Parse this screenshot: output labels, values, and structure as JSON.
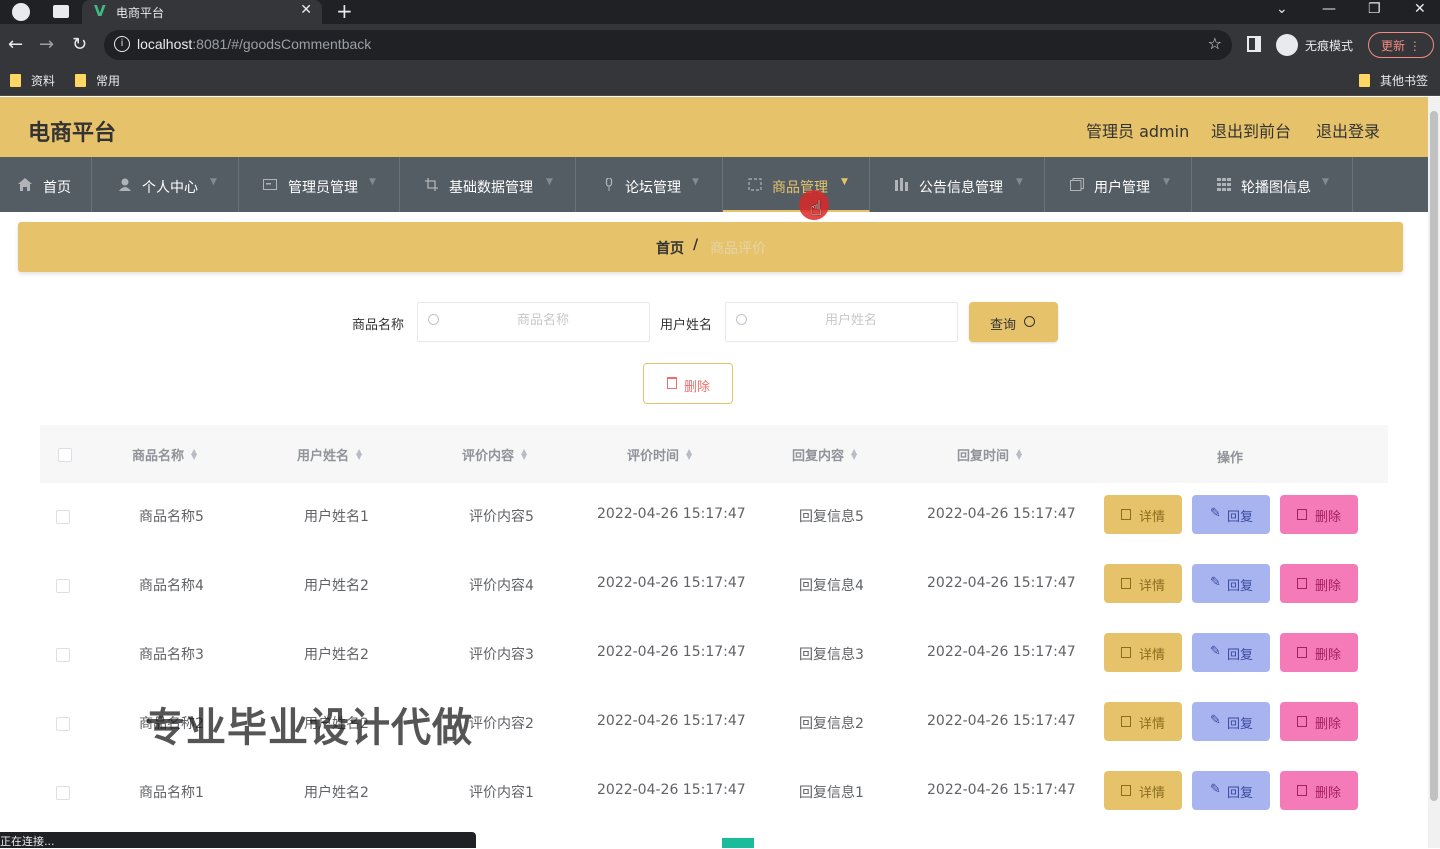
{
  "browser": {
    "tab_title": "电商平台",
    "tab_favicon": "V",
    "url_host": "localhost",
    "url_rest": ":8081/#/goodsCommentback",
    "incognito_label": "无痕模式",
    "update_label": "更新",
    "bookmarks": [
      "资料",
      "常用"
    ],
    "other_bookmarks": "其他书签",
    "status_text": "正在连接..."
  },
  "header": {
    "title": "电商平台",
    "admin": "管理员 admin",
    "back_front": "退出到前台",
    "logout": "退出登录",
    "accent_color": "#e6c36a"
  },
  "nav": {
    "items": [
      {
        "label": "首页",
        "icon": "home-icon"
      },
      {
        "label": "个人中心",
        "icon": "user-icon"
      },
      {
        "label": "管理员管理",
        "icon": "admin-icon"
      },
      {
        "label": "基础数据管理",
        "icon": "crop-icon"
      },
      {
        "label": "论坛管理",
        "icon": "mic-icon"
      },
      {
        "label": "商品管理",
        "icon": "goods-icon",
        "active": true
      },
      {
        "label": "公告信息管理",
        "icon": "notice-icon"
      },
      {
        "label": "用户管理",
        "icon": "copy-icon"
      },
      {
        "label": "轮播图信息",
        "icon": "grid-icon"
      }
    ]
  },
  "breadcrumb": {
    "home": "首页",
    "separator": "/",
    "current": "商品评价"
  },
  "search": {
    "goods_label": "商品名称",
    "goods_placeholder": "商品名称",
    "user_label": "用户姓名",
    "user_placeholder": "用户姓名",
    "query_label": "查询"
  },
  "bulk_delete_label": "删除",
  "table": {
    "headers": [
      "商品名称",
      "用户姓名",
      "评价内容",
      "评价时间",
      "回复内容",
      "回复时间",
      "操作"
    ],
    "actions": {
      "detail": "详情",
      "reply": "回复",
      "delete": "删除"
    },
    "rows": [
      [
        "商品名称5",
        "用户姓名1",
        "评价内容5",
        "2022-04-26 15:17:47",
        "回复信息5",
        "2022-04-26 15:17:47"
      ],
      [
        "商品名称4",
        "用户姓名2",
        "评价内容4",
        "2022-04-26 15:17:47",
        "回复信息4",
        "2022-04-26 15:17:47"
      ],
      [
        "商品名称3",
        "用户姓名2",
        "评价内容3",
        "2022-04-26 15:17:47",
        "回复信息3",
        "2022-04-26 15:17:47"
      ],
      [
        "商品名称2",
        "用户姓名2",
        "评价内容2",
        "2022-04-26 15:17:47",
        "回复信息2",
        "2022-04-26 15:17:47"
      ],
      [
        "商品名称1",
        "用户姓名2",
        "评价内容1",
        "2022-04-26 15:17:47",
        "回复信息1",
        "2022-04-26 15:17:47"
      ]
    ]
  },
  "watermark": "专业毕业设计代做"
}
